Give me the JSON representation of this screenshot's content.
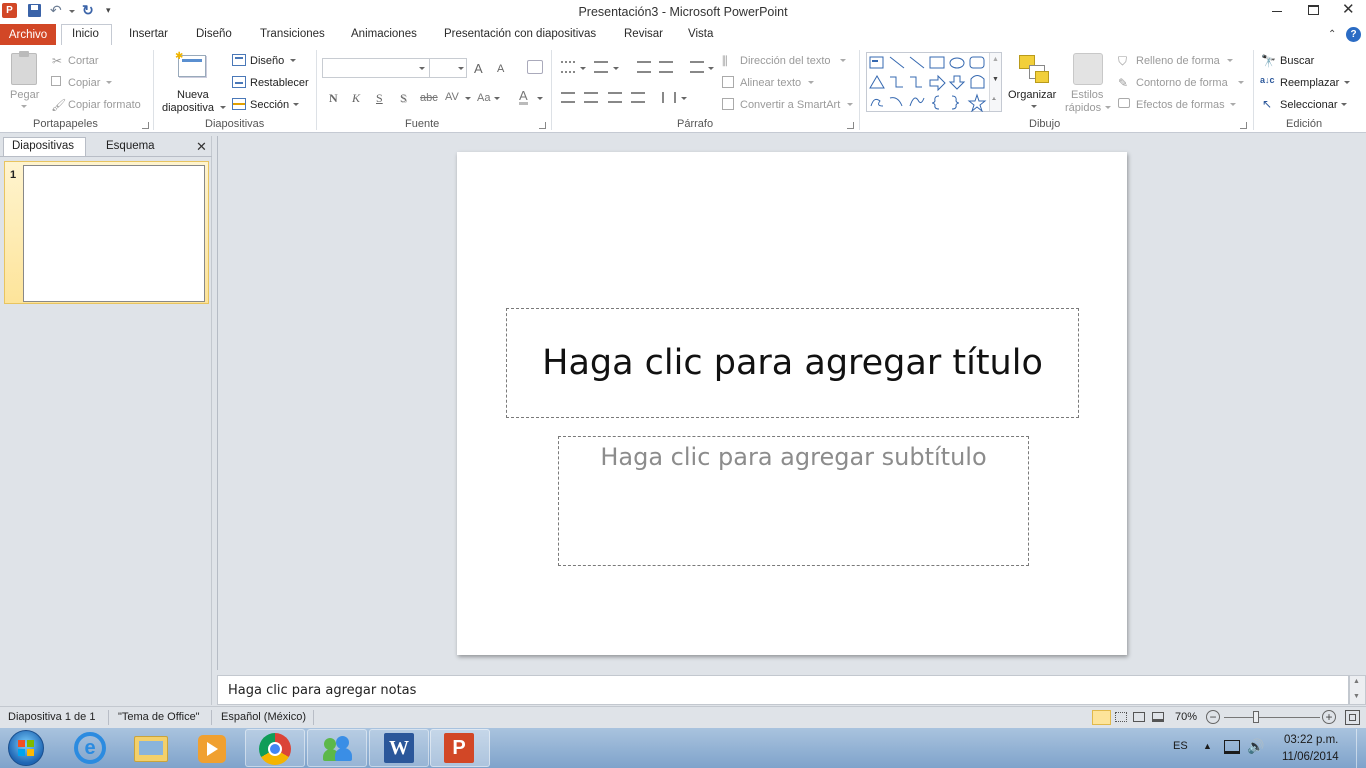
{
  "window": {
    "title": "Presentación3  -  Microsoft PowerPoint",
    "controls": [
      "minimize",
      "restore",
      "close"
    ]
  },
  "quick_access": {
    "icons": [
      "powerpoint-logo-icon",
      "save-icon",
      "undo-icon",
      "redo-icon",
      "customize-icon"
    ]
  },
  "tabs": {
    "file": "Archivo",
    "items": [
      "Inicio",
      "Insertar",
      "Diseño",
      "Transiciones",
      "Animaciones",
      "Presentación con diapositivas",
      "Revisar",
      "Vista"
    ],
    "active": "Inicio"
  },
  "ribbon": {
    "portapapeles": {
      "label": "Portapapeles",
      "pegar": "Pegar",
      "cortar": "Cortar",
      "copiar": "Copiar",
      "copiar_formato": "Copiar formato"
    },
    "diapositivas": {
      "label": "Diapositivas",
      "nueva_line1": "Nueva",
      "nueva_line2": "diapositiva",
      "diseno": "Diseño",
      "restablecer": "Restablecer",
      "seccion": "Sección"
    },
    "fuente": {
      "label": "Fuente",
      "font_value": "",
      "size_value": "",
      "grow": "A",
      "shrink": "A",
      "bold": "N",
      "italic": "K",
      "underline": "S",
      "shadow": "S",
      "strike": "abc",
      "spacing": "AV",
      "case": "Aa",
      "color": "A"
    },
    "parrafo": {
      "label": "Párrafo",
      "direccion": "Dirección del texto",
      "alinear": "Alinear texto",
      "smartart": "Convertir a SmartArt"
    },
    "dibujo": {
      "label": "Dibujo",
      "organizar": "Organizar",
      "estilos_line1": "Estilos",
      "estilos_line2": "rápidos",
      "relleno": "Relleno de forma",
      "contorno": "Contorno de forma",
      "efectos": "Efectos de formas"
    },
    "edicion": {
      "label": "Edición",
      "buscar": "Buscar",
      "reemplazar": "Reemplazar",
      "seleccionar": "Seleccionar"
    }
  },
  "leftpanel": {
    "tab_slides": "Diapositivas",
    "tab_outline": "Esquema",
    "thumb_number": "1"
  },
  "slide": {
    "title_placeholder": "Haga clic para agregar título",
    "subtitle_placeholder": "Haga clic para agregar subtítulo"
  },
  "notes": {
    "placeholder": "Haga clic para agregar notas"
  },
  "statusbar": {
    "slide_info": "Diapositiva 1 de 1",
    "theme": "\"Tema de Office\"",
    "language": "Español (México)",
    "zoom": "70%",
    "zoom_level": 0.7
  },
  "taskbar": {
    "apps": [
      "start-orb-icon",
      "internet-explorer-icon",
      "file-explorer-icon",
      "media-player-icon",
      "chrome-icon",
      "messenger-icon",
      "word-icon",
      "powerpoint-icon"
    ],
    "lang": "ES",
    "time": "03:22 p.m.",
    "date": "11/06/2014"
  },
  "colors": {
    "file_tab": "#d24726",
    "accent": "#2b579a",
    "taskbar": "#8cb0d6"
  }
}
